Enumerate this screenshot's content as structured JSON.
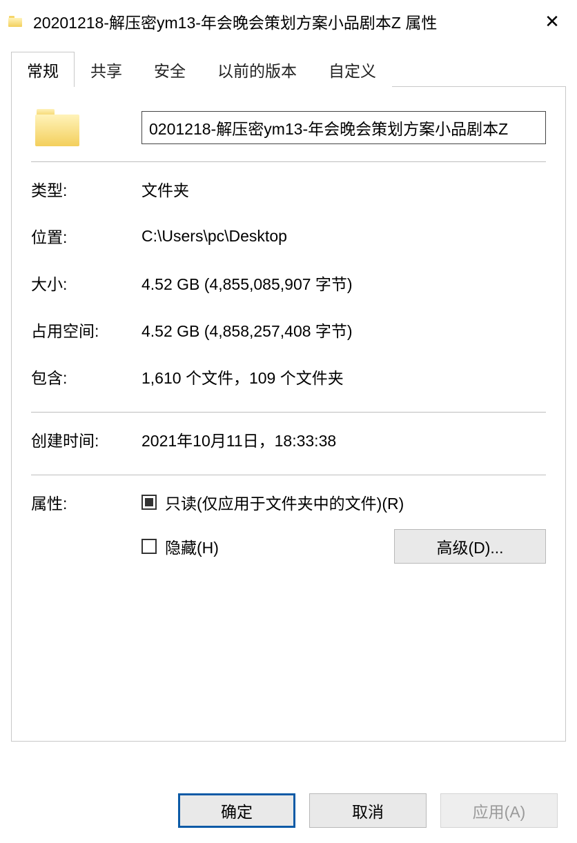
{
  "window": {
    "title": "20201218-解压密ym13-年会晚会策划方案小品剧本Z 属性"
  },
  "tabs": {
    "general": "常规",
    "sharing": "共享",
    "security": "安全",
    "previous": "以前的版本",
    "custom": "自定义"
  },
  "name_value": "0201218-解压密ym13-年会晚会策划方案小品剧本Z",
  "rows": {
    "type_label": "类型:",
    "type_value": "文件夹",
    "location_label": "位置:",
    "location_value": "C:\\Users\\pc\\Desktop",
    "size_label": "大小:",
    "size_value": "4.52 GB (4,855,085,907 字节)",
    "sizeondisk_label": "占用空间:",
    "sizeondisk_value": "4.52 GB (4,858,257,408 字节)",
    "contains_label": "包含:",
    "contains_value": "1,610 个文件，109 个文件夹",
    "created_label": "创建时间:",
    "created_value": "2021年10月11日，18:33:38",
    "attr_label": "属性:",
    "readonly_label": "只读(仅应用于文件夹中的文件)(R)",
    "hidden_label": "隐藏(H)",
    "advanced_label": "高级(D)..."
  },
  "footer": {
    "ok": "确定",
    "cancel": "取消",
    "apply": "应用(A)"
  }
}
